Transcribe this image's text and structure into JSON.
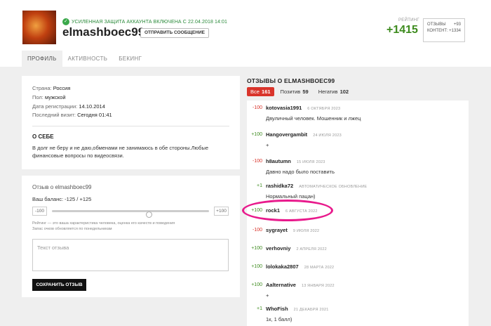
{
  "profile": {
    "security_notice": "УСИЛЕННАЯ ЗАЩИТА АККАУНТА ВКЛЮЧЕНА С 22.04.2018 14:01",
    "username": "elmashboec99",
    "message_button": "ОТПРАВИТЬ СООБЩЕНИЕ",
    "rating_label": "РЕЙТИНГ",
    "rating_value": "+1415",
    "stats": [
      {
        "label": "ОТЗЫВЫ",
        "value": "+93"
      },
      {
        "label": "КОНТЕНТ:",
        "value": "+1334"
      }
    ]
  },
  "tabs": [
    "ПРОФИЛЬ",
    "АКТИВНОСТЬ",
    "БЕКИНГ"
  ],
  "info": {
    "rows": [
      {
        "label": "Страна:",
        "value": "Россия"
      },
      {
        "label": "Пол:",
        "value": "мужской"
      },
      {
        "label": "Дата регистрации:",
        "value": "14.10.2014"
      },
      {
        "label": "Последний визит:",
        "value": "Сегодня 01:41"
      }
    ],
    "about_title": "О СЕБЕ",
    "about_text": "В долг не беру и не даю,обменами не занимаюсь в обе стороны.Любые финансовые вопросы по видеосвязи."
  },
  "review_form": {
    "title": "Отзыв о elmashboec99",
    "balance": "Ваш баланс: -125 / +125",
    "min_label": "-100",
    "max_label": "+100",
    "slider_value": 0,
    "hint_line1": "Рейтинг — это ваша характеристика человека, оценка его качеств и поведения",
    "hint_line2": "Запас очков обновляется по понедельникам",
    "textarea_placeholder": "Текст отзыва",
    "save_button": "СОХРАНИТЬ ОТЗЫВ"
  },
  "reviews": {
    "title": "ОТЗЫВЫ О ELMASHBOEC99",
    "filters": [
      {
        "label": "Все",
        "count": "161",
        "active": true
      },
      {
        "label": "Позитив",
        "count": "59",
        "active": false
      },
      {
        "label": "Негатив",
        "count": "102",
        "active": false
      }
    ],
    "items": [
      {
        "score": "-100",
        "type": "neg",
        "name": "kotovasia1991",
        "date": "6 ОКТЯБРЯ 2023",
        "text": "Двуличный человек. Мошенник и лжец"
      },
      {
        "score": "+100",
        "type": "pos",
        "name": "Hangovergambit",
        "date": "24 ИЮЛЯ 2023",
        "text": "+"
      },
      {
        "score": "-100",
        "type": "neg",
        "name": "h8autumn",
        "date": "15 ИЮЛЯ 2023",
        "text": "Давно надо было поставить"
      },
      {
        "score": "+1",
        "type": "pos",
        "name": "rashidka72",
        "date": "АВТОМАТИЧЕСКОЕ ОБНОВЛЕНИЕ",
        "text": "Нормальный пацан)"
      },
      {
        "score": "+100",
        "type": "pos",
        "name": "rock1",
        "date": "6 АВГУСТА 2022",
        "text": ""
      },
      {
        "score": "-100",
        "type": "neg",
        "name": "sygrayet",
        "date": "9 ИЮЛЯ 2022",
        "text": ""
      },
      {
        "score": "+100",
        "type": "pos",
        "name": "verhovniy",
        "date": "2 АПРЕЛЯ 2022",
        "text": ""
      },
      {
        "score": "+100",
        "type": "pos",
        "name": "lolokaka2807",
        "date": "28 МАРТА 2022",
        "text": ""
      },
      {
        "score": "+100",
        "type": "pos",
        "name": "Aalternative",
        "date": "13 ЯНВАРЯ 2022",
        "text": "+"
      },
      {
        "score": "+1",
        "type": "pos",
        "name": "WhoFish",
        "date": "21 ДЕКАБРЯ 2021",
        "text": "1к, 1 балл)"
      }
    ]
  }
}
